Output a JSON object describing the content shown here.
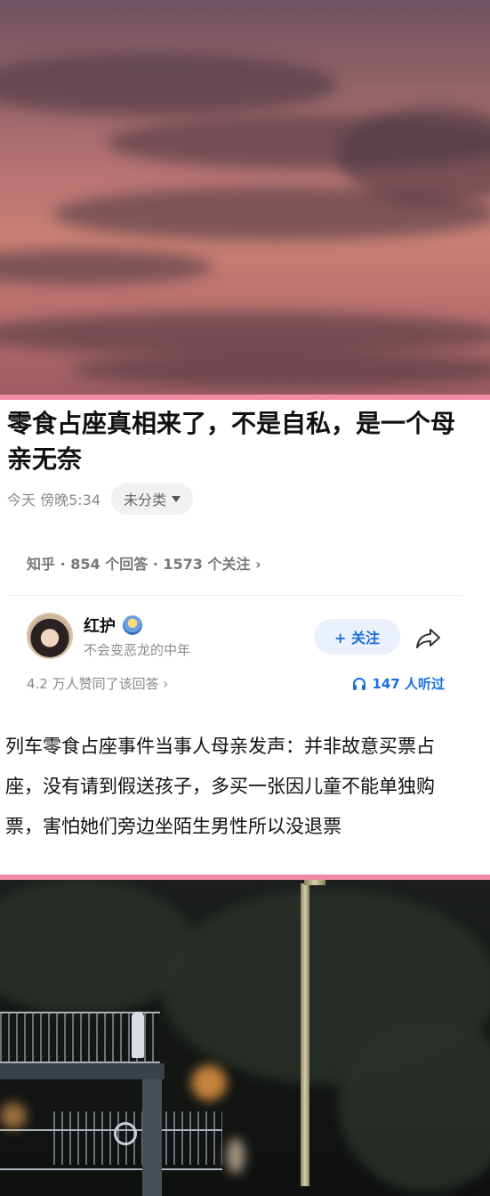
{
  "article": {
    "title": "零食占座真相来了，不是自私，是一个母亲无奈",
    "time": "今天 傍晚5:34",
    "category": "未分类",
    "source_line": "知乎 · 854 个回答 · 1573 个关注 ›"
  },
  "author": {
    "name": "红护",
    "bio": "不会变恶龙的中年",
    "follow_label": "+ 关注",
    "agree_text": "4.2 万人赞同了该回答 ›",
    "listen_text": "147 人听过"
  },
  "body": {
    "text": "列车零食占座事件当事人母亲发声：并非故意买票占座，没有请到假送孩子，多买一张因儿童不能单独购票，害怕她们旁边坐陌生男性所以没退票"
  },
  "colors": {
    "accent_pink": "#f08aa4",
    "follow_blue": "#1a6de0",
    "follow_bg": "#eaf1fc"
  },
  "icons": {
    "dropdown": "triangle-down-icon",
    "share": "share-arrow-icon",
    "headphones": "headphones-icon",
    "badge": "badge-icon"
  }
}
